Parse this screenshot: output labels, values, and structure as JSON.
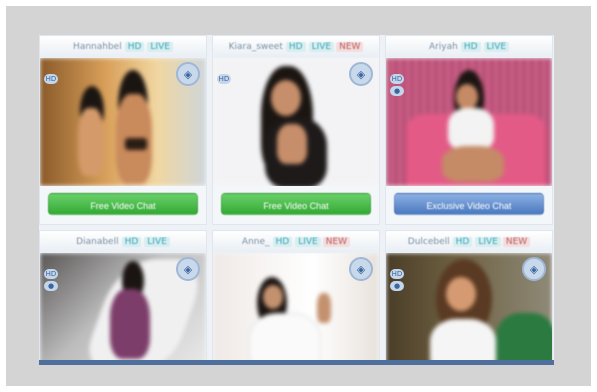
{
  "cards": [
    {
      "name": "Hannahbel",
      "tags": [
        "HD",
        "LIVE"
      ],
      "button": "Free Video Chat",
      "button_style": "green",
      "badge_icon": "shield-icon",
      "colors": {
        "bg": "#d9a05a",
        "accent": "#f1d6a0"
      }
    },
    {
      "name": "Kiara_sweet",
      "tags": [
        "HD",
        "LIVE",
        "NEW"
      ],
      "button": "Free Video Chat",
      "button_style": "green",
      "badge_icon": "shield-icon",
      "colors": {
        "bg": "#f3f3f5",
        "accent": "#e8e4e2"
      }
    },
    {
      "name": "Ariyah",
      "tags": [
        "HD",
        "LIVE"
      ],
      "button": "Exclusive Video Chat",
      "button_style": "blue",
      "badge_icon": "shield-icon",
      "colors": {
        "bg": "#b84d72",
        "accent": "#e35a86"
      }
    },
    {
      "name": "Dianabell",
      "tags": [
        "HD",
        "LIVE"
      ],
      "button": "",
      "badge_icon": "shield-icon",
      "colors": {
        "bg": "#bdbdbd",
        "accent": "#e9e9e9"
      }
    },
    {
      "name": "Anne_",
      "tags": [
        "HD",
        "LIVE",
        "NEW"
      ],
      "button": "",
      "badge_icon": "shield-icon",
      "colors": {
        "bg": "#efe9e6",
        "accent": "#ffffff"
      }
    },
    {
      "name": "Dulcebell",
      "tags": [
        "HD",
        "LIVE",
        "NEW"
      ],
      "button": "",
      "badge_icon": "shield-icon",
      "colors": {
        "bg": "#6c5f40",
        "accent": "#2b7a40"
      }
    }
  ]
}
